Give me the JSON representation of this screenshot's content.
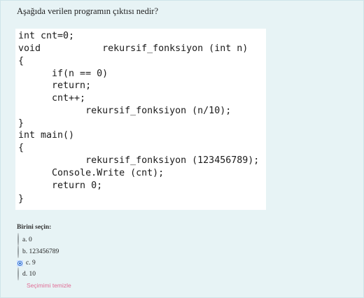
{
  "question": {
    "text": "Aşağıda verilen programın çıktısı nedir?"
  },
  "code": {
    "lines": [
      "int cnt=0;",
      "void           rekursif_fonksiyon (int n)",
      "{",
      "      if(n == 0)",
      "      return;",
      "      cnt++;",
      "            rekursif_fonksiyon (n/10);",
      "}",
      "int main()",
      "{",
      "            rekursif_fonksiyon (123456789);",
      "      Console.Write (cnt);",
      "      return 0;",
      "}"
    ]
  },
  "answers": {
    "prompt": "Birini seçin:",
    "options": [
      {
        "label": "a. 0",
        "selected": false
      },
      {
        "label": "b. 123456789",
        "selected": false
      },
      {
        "label": "c. 9",
        "selected": true
      },
      {
        "label": "d. 10",
        "selected": false
      }
    ],
    "clear_label": "Seçimimi temizle"
  }
}
